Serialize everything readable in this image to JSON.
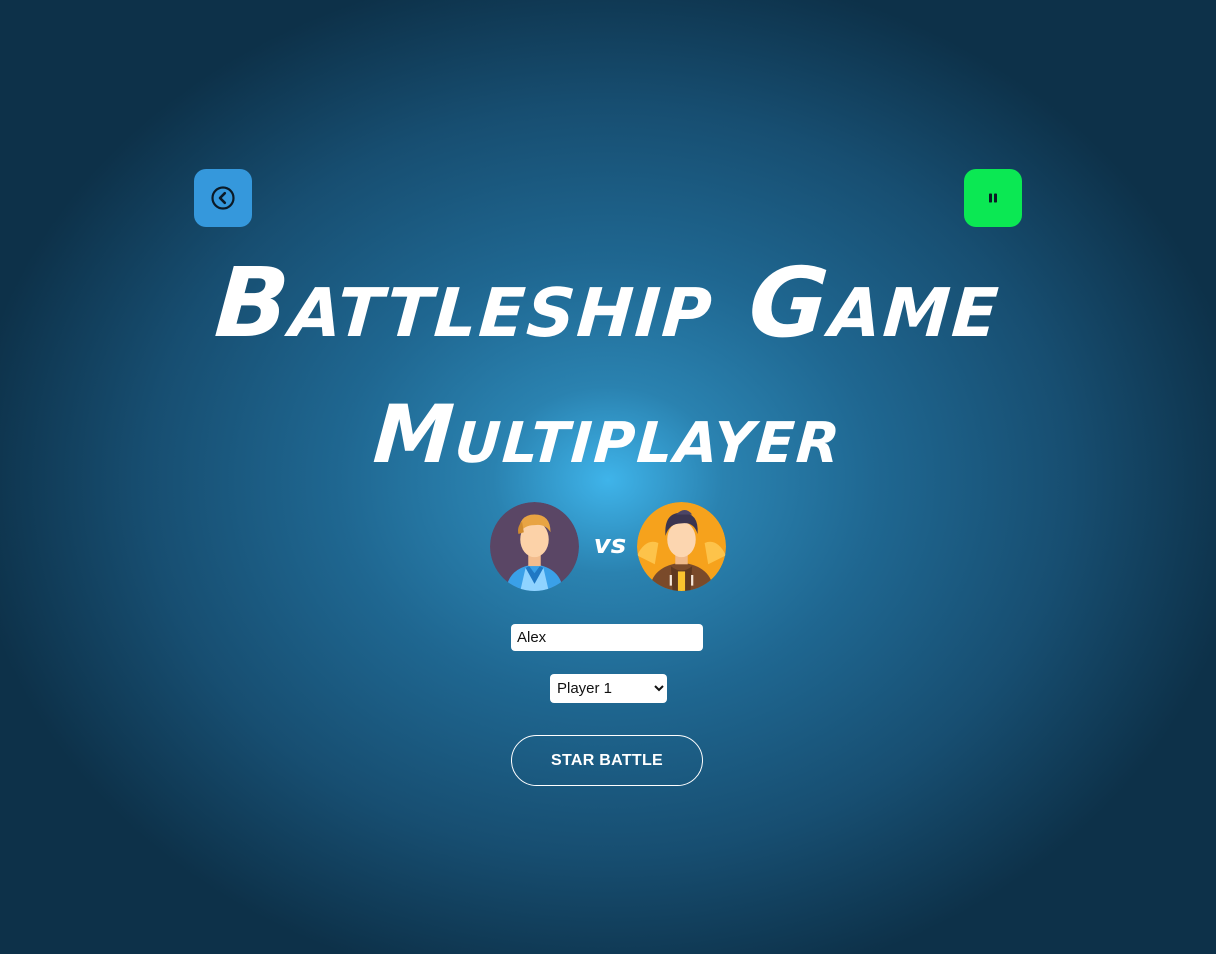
{
  "controls": {
    "back_icon": "circle-chevron-left-icon",
    "pause_icon": "pause-icon",
    "back_color": "#3598dc",
    "pause_color": "#0be853"
  },
  "header": {
    "title": "Battleship Game",
    "subtitle": "Multiplayer"
  },
  "matchup": {
    "player1_avatar": "blond-man-blue-jacket-avatar",
    "vs_label": "vs",
    "player2_avatar": "dark-hair-man-brown-hoodie-avatar"
  },
  "form": {
    "name_value": "Alex",
    "player_select_value": "Player 1",
    "start_button_label": "STAR BATTLE"
  }
}
